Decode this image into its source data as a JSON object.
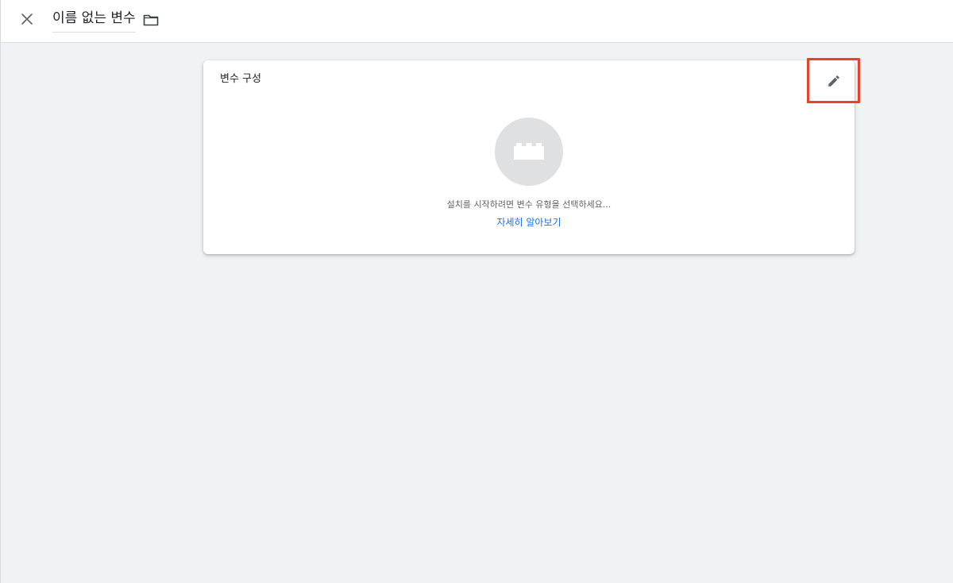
{
  "header": {
    "title": "이름 없는 변수",
    "close_icon": "close-icon",
    "folder_icon": "folder-icon"
  },
  "card": {
    "title": "변수 구성",
    "edit_icon": "pencil-icon",
    "placeholder_icon": "building-block-icon",
    "hint": "설치를 시작하려면 변수 유형을 선택하세요...",
    "learn_more": "자세히 알아보기"
  },
  "colors": {
    "background": "#f1f2f4",
    "card": "#ffffff",
    "highlight_border": "#e8412d",
    "link": "#1a73e8",
    "placeholder_circle": "#dfe0e2"
  }
}
